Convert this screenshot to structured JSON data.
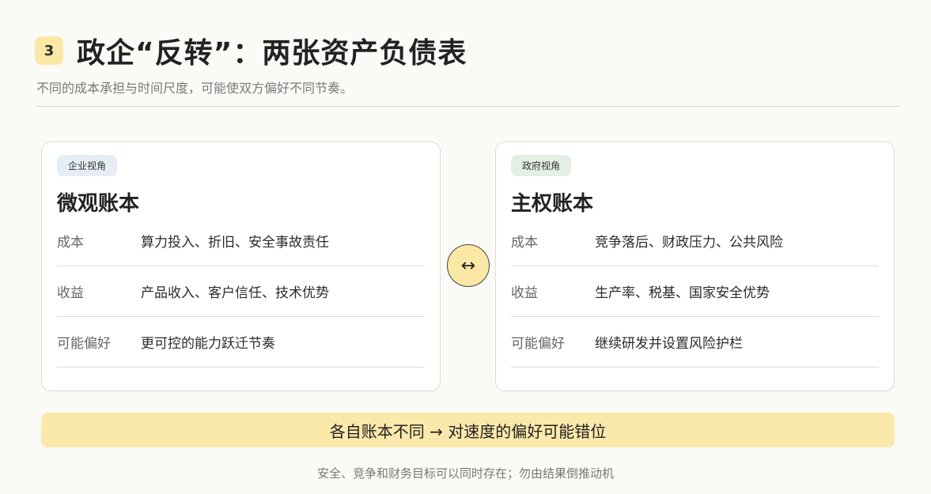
{
  "header": {
    "number": "3",
    "title": "政企“反转”：两张资产负债表",
    "subtitle": "不同的成本承担与时间尺度，可能使双方偏好不同节奏。"
  },
  "left_card": {
    "tag": "企业视角",
    "title": "微观账本",
    "rows": [
      {
        "label": "成本",
        "value": "算力投入、折旧、安全事故责任"
      },
      {
        "label": "收益",
        "value": "产品收入、客户信任、技术优势"
      },
      {
        "label": "可能偏好",
        "value": "更可控的能力跃迁节奏"
      }
    ]
  },
  "right_card": {
    "tag": "政府视角",
    "title": "主权账本",
    "rows": [
      {
        "label": "成本",
        "value": "竞争落后、财政压力、公共风险"
      },
      {
        "label": "收益",
        "value": "生产率、税基、国家安全优势"
      },
      {
        "label": "可能偏好",
        "value": "继续研发并设置风险护栏"
      }
    ]
  },
  "swap_icon": "↔",
  "banner": "各自账本不同 → 对速度的偏好可能错位",
  "footnote": "安全、竞争和财务目标可以同时存在；勿由结果倒推动机",
  "colors": {
    "accent_yellow": "#fbe7a6",
    "tag_blue": "#e6edf5",
    "tag_green": "#e3efe5"
  }
}
